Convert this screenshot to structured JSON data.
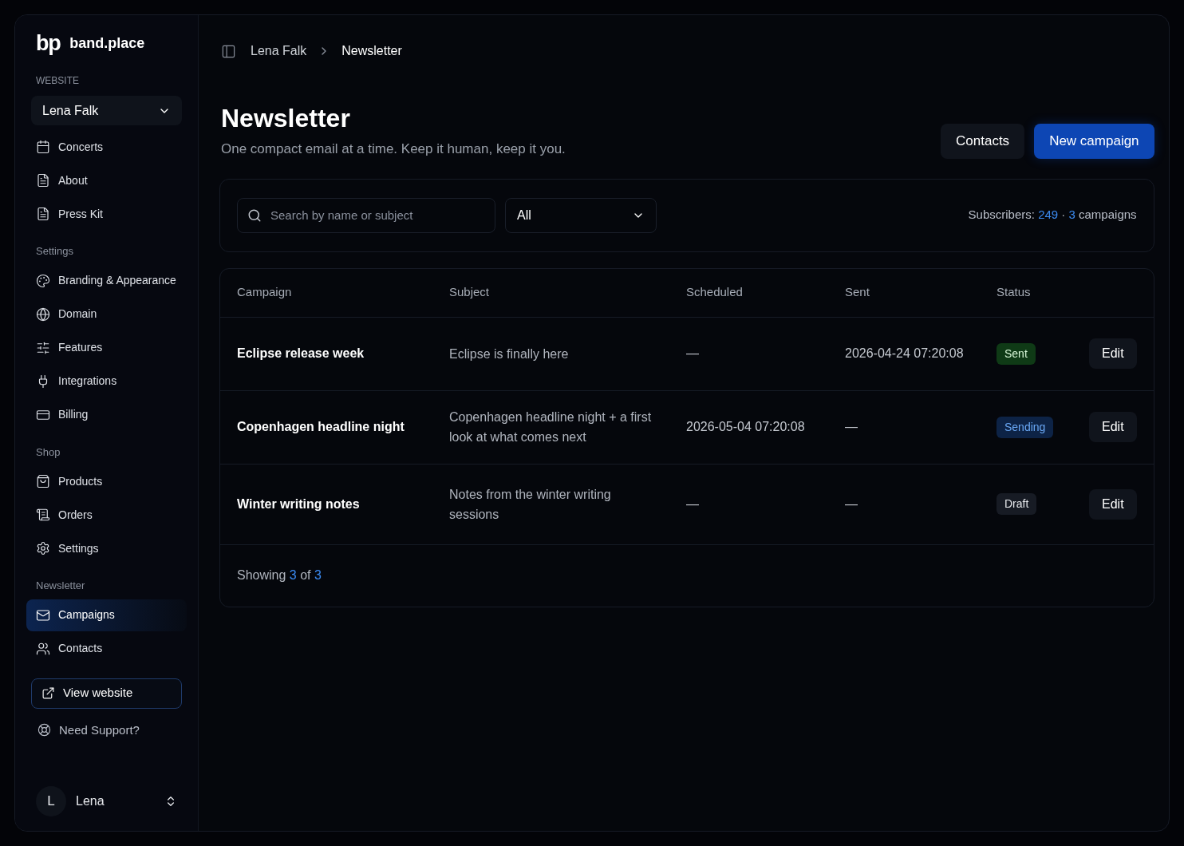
{
  "brand": {
    "logo": "bp",
    "name": "band.place"
  },
  "website": {
    "label": "WEBSITE",
    "value": "Lena Falk"
  },
  "sidebar": {
    "sections": [
      {
        "items": [
          {
            "label": "Concerts",
            "selected": false
          },
          {
            "label": "About",
            "selected": false
          },
          {
            "label": "Press Kit",
            "selected": false
          }
        ]
      },
      {
        "title": "Settings",
        "items": [
          {
            "label": "Branding & Appearance",
            "selected": false
          },
          {
            "label": "Domain",
            "selected": false
          },
          {
            "label": "Features",
            "selected": false
          },
          {
            "label": "Integrations",
            "selected": false
          },
          {
            "label": "Billing",
            "selected": false
          }
        ]
      },
      {
        "title": "Shop",
        "items": [
          {
            "label": "Products",
            "selected": false
          },
          {
            "label": "Orders",
            "selected": false
          },
          {
            "label": "Settings",
            "selected": false
          }
        ]
      },
      {
        "title": "Newsletter",
        "items": [
          {
            "label": "Campaigns",
            "selected": true
          },
          {
            "label": "Contacts",
            "selected": false
          }
        ]
      }
    ],
    "view_website": "View website",
    "support": "Need Support?"
  },
  "user": {
    "initial": "L",
    "name": "Lena"
  },
  "breadcrumb": [
    "Lena Falk",
    "Newsletter"
  ],
  "page": {
    "title": "Newsletter",
    "subtitle": "One compact email at a time. Keep it human, keep it you.",
    "buttons": [
      "Contacts",
      "New campaign"
    ]
  },
  "filters": {
    "search_placeholder": "Search by name or subject",
    "status": "All",
    "subscribers_label": "Subscribers:",
    "subscribers": "249",
    "separator": "·",
    "campaigns_count": "3",
    "campaigns_label": "campaigns"
  },
  "table": {
    "columns": [
      "Campaign",
      "Subject",
      "Scheduled",
      "Sent",
      "Status"
    ],
    "rows": [
      {
        "campaign": "Eclipse release week",
        "subject": "Eclipse is finally here",
        "scheduled": "—",
        "sent": "2026-04-24 07:20:08",
        "status": "Sent",
        "kind": "sent",
        "action": "Edit"
      },
      {
        "campaign": "Copenhagen headline night",
        "subject": "Copenhagen headline night + a first look at what comes next",
        "scheduled": "2026-05-04 07:20:08",
        "sent": "—",
        "status": "Sending",
        "kind": "sending",
        "action": "Edit"
      },
      {
        "campaign": "Winter writing notes",
        "subject": "Notes from the winter writing sessions",
        "scheduled": "—",
        "sent": "—",
        "status": "Draft",
        "kind": "draft",
        "action": "Edit"
      }
    ],
    "footer": {
      "showing": "Showing",
      "shown": "3",
      "of": "of",
      "total": "3"
    }
  }
}
